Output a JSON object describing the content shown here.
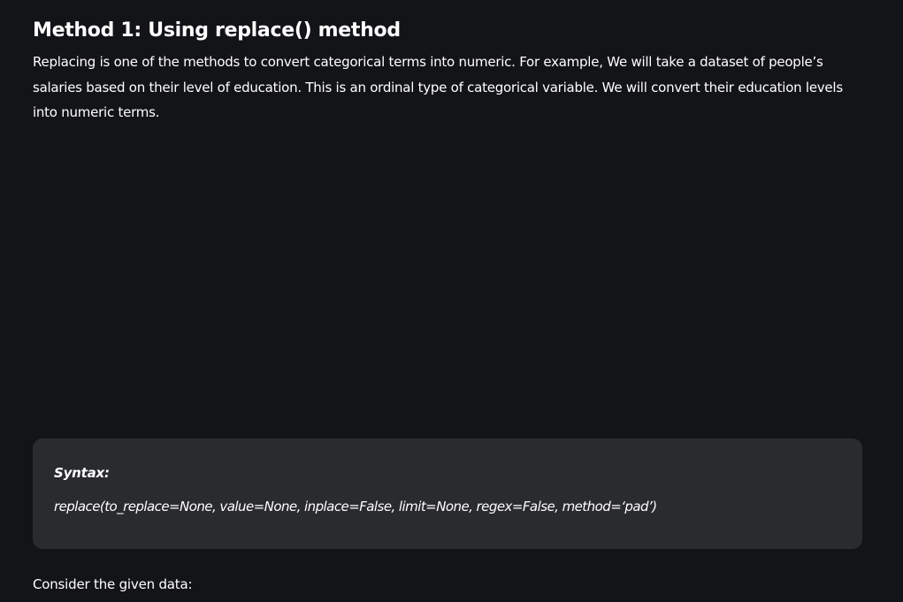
{
  "article": {
    "heading": "Method 1: Using replace() method",
    "intro": "Replacing is one of the methods to convert categorical terms into numeric. For example, We will take a dataset of people’s salaries based on their level of education. This is an ordinal type of categorical variable. We will convert their education levels into numeric terms.",
    "syntax": {
      "label": "Syntax:",
      "code": "replace(to_replace=None, value=None, inplace=False, limit=None, regex=False, method=‘pad’)"
    },
    "after_text": "Consider the given data:"
  },
  "colors": {
    "background": "#131417",
    "text": "#ffffff",
    "syntax_box": "#2a2b2e"
  }
}
